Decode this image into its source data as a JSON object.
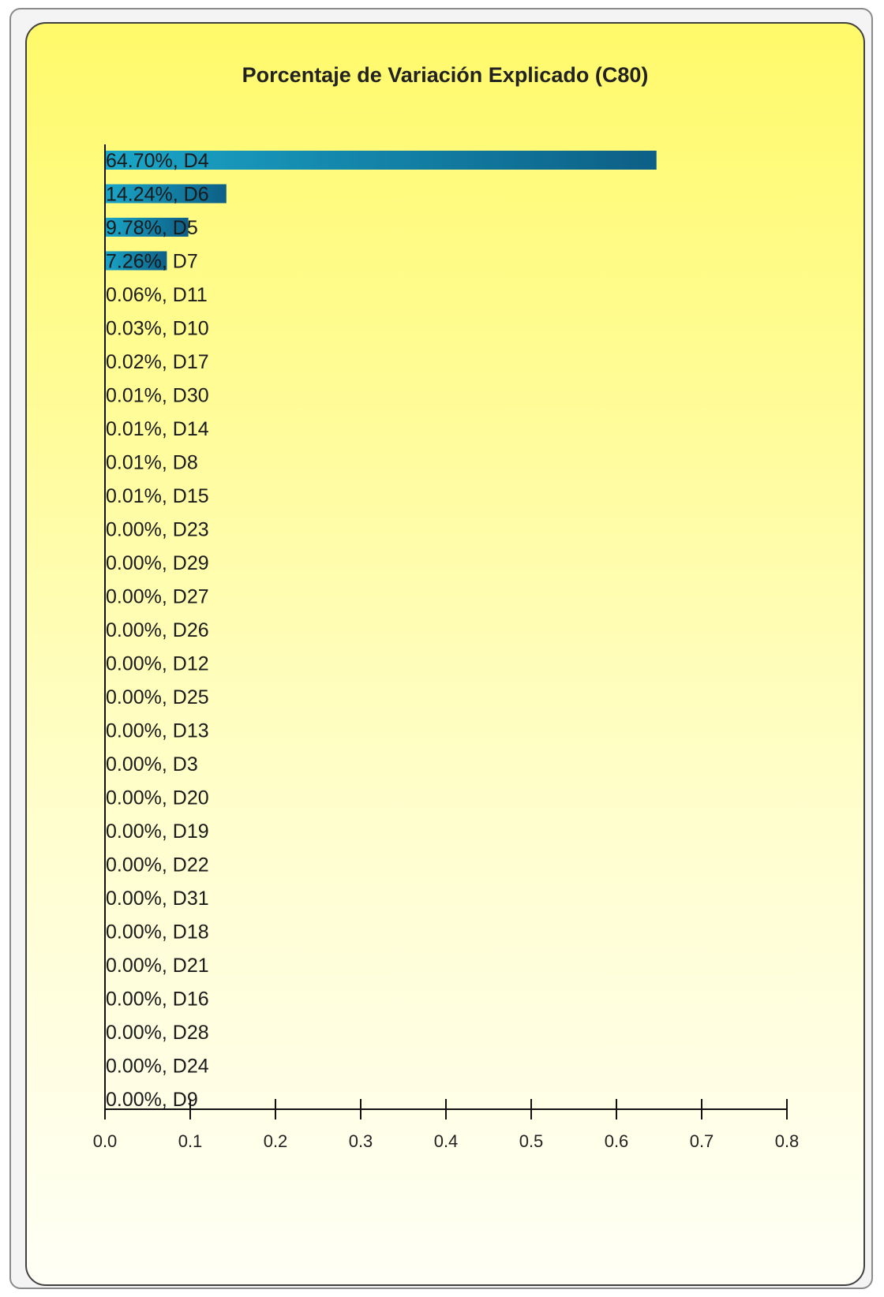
{
  "chart_data": {
    "type": "bar",
    "orientation": "horizontal",
    "title": "Porcentaje de Variación Explicado (C80)",
    "xlim": [
      0,
      0.8
    ],
    "xticks": [
      "0.0",
      "0.1",
      "0.2",
      "0.3",
      "0.4",
      "0.5",
      "0.6",
      "0.7",
      "0.8"
    ],
    "bars": [
      {
        "label": "64.70%, D4",
        "value": 0.647
      },
      {
        "label": "14.24%, D6",
        "value": 0.1424
      },
      {
        "label": "9.78%, D5",
        "value": 0.0978
      },
      {
        "label": "7.26%, D7",
        "value": 0.0726
      },
      {
        "label": "0.06%, D11",
        "value": 0.0006
      },
      {
        "label": "0.03%, D10",
        "value": 0.0003
      },
      {
        "label": "0.02%, D17",
        "value": 0.0002
      },
      {
        "label": "0.01%, D30",
        "value": 0.0001
      },
      {
        "label": "0.01%, D14",
        "value": 0.0001
      },
      {
        "label": "0.01%, D8",
        "value": 0.0001
      },
      {
        "label": "0.01%, D15",
        "value": 0.0001
      },
      {
        "label": "0.00%, D23",
        "value": 0
      },
      {
        "label": "0.00%, D29",
        "value": 0
      },
      {
        "label": "0.00%, D27",
        "value": 0
      },
      {
        "label": "0.00%, D26",
        "value": 0
      },
      {
        "label": "0.00%, D12",
        "value": 0
      },
      {
        "label": "0.00%, D25",
        "value": 0
      },
      {
        "label": "0.00%, D13",
        "value": 0
      },
      {
        "label": "0.00%, D3",
        "value": 0
      },
      {
        "label": "0.00%, D20",
        "value": 0
      },
      {
        "label": "0.00%, D19",
        "value": 0
      },
      {
        "label": "0.00%, D22",
        "value": 0
      },
      {
        "label": "0.00%, D31",
        "value": 0
      },
      {
        "label": "0.00%, D18",
        "value": 0
      },
      {
        "label": "0.00%, D21",
        "value": 0
      },
      {
        "label": "0.00%, D16",
        "value": 0
      },
      {
        "label": "0.00%, D28",
        "value": 0
      },
      {
        "label": "0.00%, D24",
        "value": 0
      },
      {
        "label": "0.00%, D9",
        "value": 0
      }
    ],
    "bar_color": "#1aa6c8",
    "bar_color_dark": "#0d5f86",
    "grid": false,
    "legend": "none"
  }
}
